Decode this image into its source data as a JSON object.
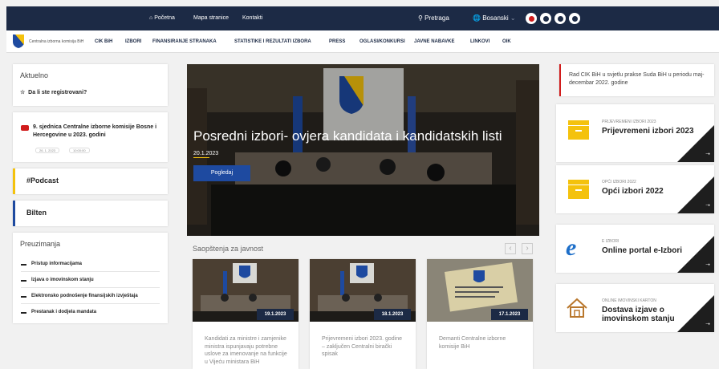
{
  "topbar": {
    "home": "Početna",
    "sitemap": "Mapa stranice",
    "contacts": "Kontakti",
    "search": "Pretraga",
    "language": "Bosanski"
  },
  "nav": {
    "logo_text": "Centralna izborna komisija BiH",
    "items": [
      "CIK BiH",
      "IZBORI",
      "FINANSIRANJE STRANAKA",
      "STATISTIKE I REZULTATI IZBORA",
      "PRESS",
      "OGLASI/KONKURSI",
      "JAVNE NABAVKE",
      "LINKOVI",
      "OIK"
    ]
  },
  "left": {
    "aktuelno_title": "Aktuelno",
    "aktuelno_link": "Da li ste registrovani?",
    "session_title": "9. sjednica Centralne izborne komisije Bosne i Hercegovine u 2023. godini",
    "session_date": "26. 1. 2023",
    "session_time": "10:00:00",
    "podcast": "#Podcast",
    "bilten": "Bilten",
    "downloads_title": "Preuzimanja",
    "downloads": [
      "Pristup informacijama",
      "Izjava o imovinskom stanju",
      "Elektronsko podnošenje finansijskih izvještaja",
      "Prestanak i dodjela mandata"
    ]
  },
  "hero": {
    "title": "Posredni izbori- ovjera kandidata i kandidatskih listi",
    "date": "20.1.2023",
    "button": "Pogledaj"
  },
  "press": {
    "title": "Saopštenja za javnost",
    "cards": [
      {
        "date": "19.1.2023",
        "text": "Kandidati za ministre i zamjenike ministra ispunjavaju potrebne uslove za imenovanje na funkcije u Vijeću ministara BiH"
      },
      {
        "date": "18.1.2023",
        "text": "Prijevremeni izbori 2023. godine – zaključen Centralni birački spisak"
      },
      {
        "date": "17.1.2023",
        "text": "Demanti Centralne izborne komisije BiH"
      }
    ]
  },
  "right": {
    "notice": "Rad CIK BiH u svjetlu prakse Suda BiH u periodu maj-decembar 2022. godine",
    "cards": [
      {
        "small": "PRIJEVREMENI IZBORI 2023",
        "big": "Prijevremeni izbori 2023"
      },
      {
        "small": "OPĆI IZBORI 2022",
        "big": "Opći izbori 2022"
      },
      {
        "small": "E IZBORI",
        "big": "Online portal e-Izbori"
      },
      {
        "small": "ONLINE IMOVINSKI KARTON",
        "big": "Dostava izjave o imovinskom stanju"
      }
    ]
  },
  "colors": {
    "navy": "#1c2a45",
    "accent_yellow": "#f4c20d",
    "brand_blue": "#1e4aa0",
    "red": "#d11c1c"
  }
}
